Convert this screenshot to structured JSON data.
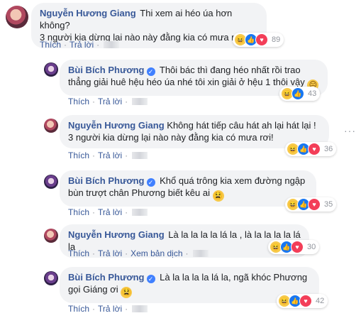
{
  "actions": {
    "like": "Thích",
    "reply": "Trả lời",
    "separator": "·",
    "translate": "Xem bản dịch"
  },
  "more_icon": "···",
  "comments": [
    {
      "author": "Nguyễn Hương Giang",
      "verified": false,
      "text": "Thi xem ai héo úa hơn không?\n3 người kia dừng lại nào này đằng kia có mưa rơi!",
      "reactions": [
        "haha",
        "like",
        "love"
      ],
      "count": "89"
    },
    {
      "author": "Bùi Bích Phương",
      "verified": true,
      "text": "Thôi bác thì đang héo nhất rồi trao thẳng giải huê hệu héo úa nhé tôi xin giải ở hệu 1 thôi vậy",
      "emoji": "😥",
      "reactions": [
        "haha",
        "like"
      ],
      "count": "43"
    },
    {
      "author": "Nguyễn Hương Giang",
      "verified": false,
      "text": "Không hát tiếp câu hát ah lại hát lại ! 3 người kia dừng lại nào này đằng kia có mưa rơi!",
      "reactions": [
        "haha",
        "like",
        "love"
      ],
      "count": "36"
    },
    {
      "author": "Bùi Bích Phương",
      "verified": true,
      "text": "Khổ quá trông kia xem đường ngập bùn trượt chân Phương biết kêu ai",
      "emoji": "😫",
      "reactions": [
        "haha",
        "like",
        "love"
      ],
      "count": "35"
    },
    {
      "author": "Nguyễn Hương Giang",
      "verified": false,
      "text": "Là la la la la lá la , là la la la la lá la",
      "reactions": [
        "haha",
        "like",
        "love"
      ],
      "count": "30"
    },
    {
      "author": "Bùi Bích Phương",
      "verified": true,
      "text": "Là la la la la lá la, ngã khóc Phương gọi Giáng ơi",
      "emoji": "😫",
      "reactions": [
        "haha",
        "like",
        "love"
      ],
      "count": "42"
    }
  ]
}
